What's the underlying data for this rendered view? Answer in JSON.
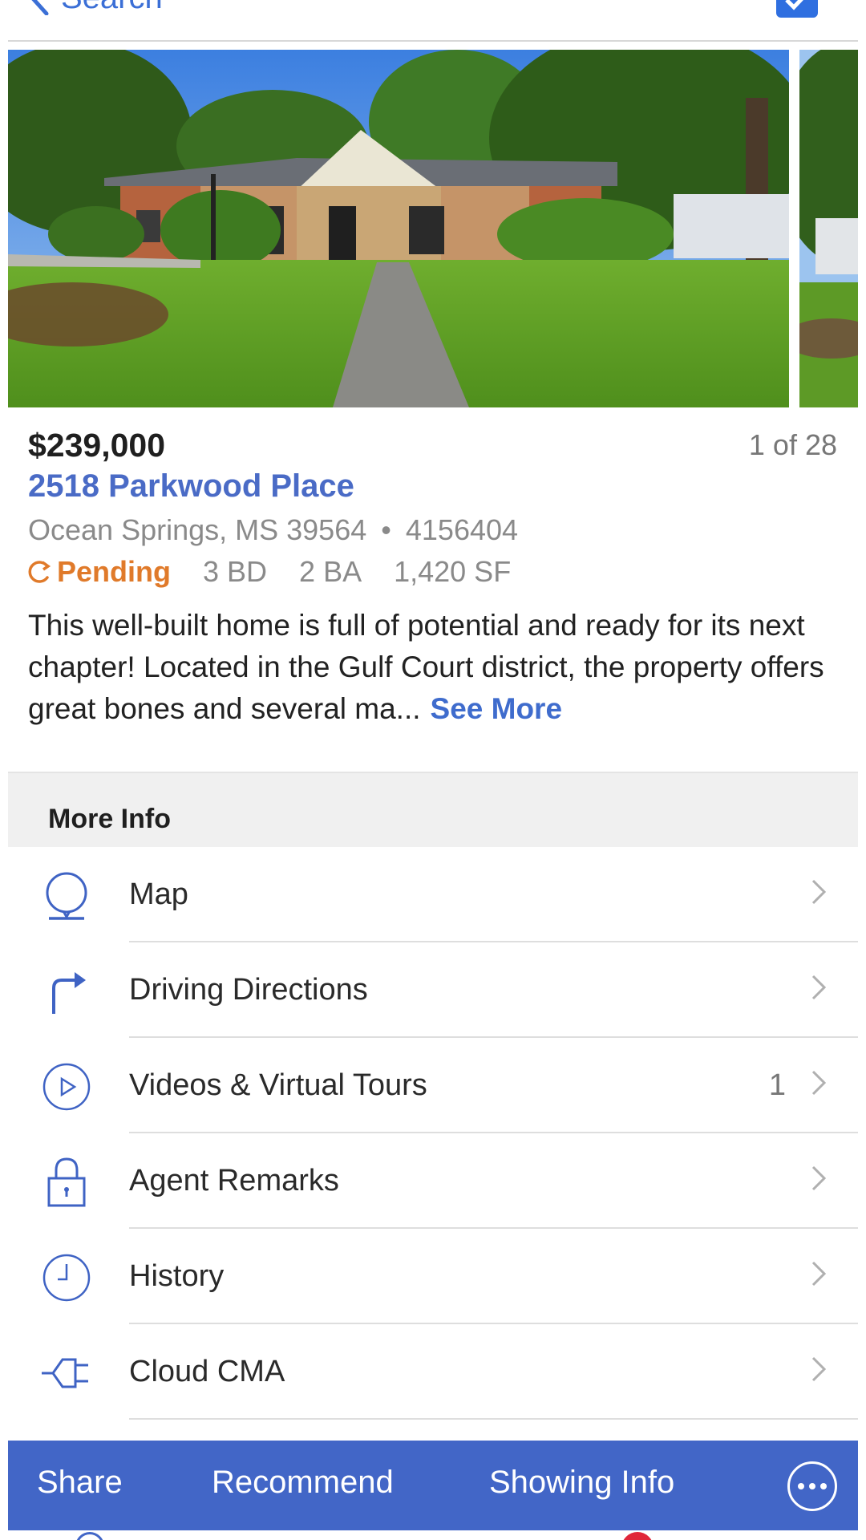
{
  "nav": {
    "back_label": "Search"
  },
  "photos": {
    "counter": "1 of 28"
  },
  "listing": {
    "price": "$239,000",
    "address": "2518 Parkwood Place",
    "location": "Ocean Springs, MS 39564",
    "separator": "•",
    "mls_number": "4156404",
    "status": "Pending",
    "beds": "3 BD",
    "baths": "2 BA",
    "sqft": "1,420 SF",
    "description": "This well-built home is full of potential and ready for its next chapter! Located in the Gulf Court district, the property offers great bones and several ma...",
    "see_more": "See More"
  },
  "more_info": {
    "title": "More Info",
    "items": [
      {
        "label": "Map",
        "icon": "map-pin-icon",
        "count": ""
      },
      {
        "label": "Driving Directions",
        "icon": "turn-arrow-icon",
        "count": ""
      },
      {
        "label": "Videos & Virtual Tours",
        "icon": "play-circle-icon",
        "count": "1"
      },
      {
        "label": "Agent Remarks",
        "icon": "lock-icon",
        "count": ""
      },
      {
        "label": "History",
        "icon": "clock-icon",
        "count": ""
      },
      {
        "label": "Cloud CMA",
        "icon": "plug-icon",
        "count": ""
      }
    ]
  },
  "actions": {
    "share": "Share",
    "recommend": "Recommend",
    "showing_info": "Showing Info"
  },
  "colors": {
    "accent": "#4266c7",
    "link": "#4a6bc6",
    "pending": "#e07a2a"
  }
}
